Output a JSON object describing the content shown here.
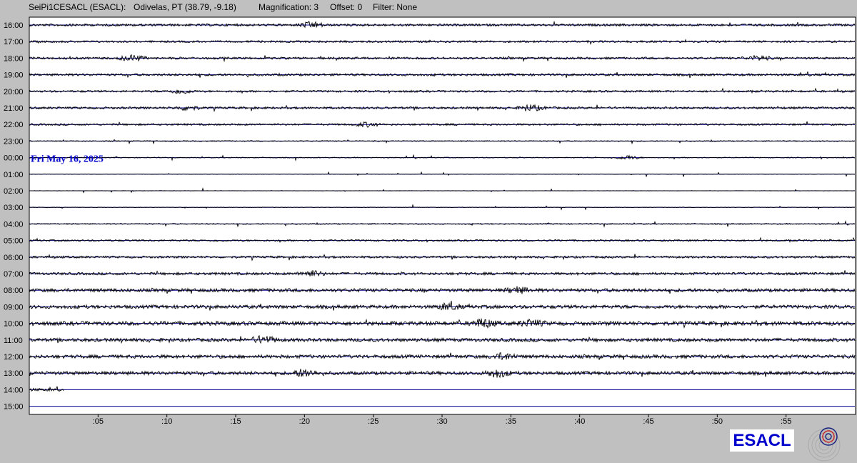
{
  "header": {
    "station": "SeiPi1CESACL (ESACL):",
    "location": "Odivelas, PT (38.79, -9.18)",
    "magnification": "Magnification: 3",
    "offset": "Offset: 0",
    "filter": "Filter: None"
  },
  "logo_text": "ESACL",
  "colors": {
    "trace": "#000000",
    "baseline": "#00008b",
    "date_label": "#0000cc",
    "background": "#c0c0c0",
    "plot": "#ffffff"
  },
  "chart_data": {
    "type": "line",
    "title": "",
    "date_annotation": {
      "text": "Fri May 16, 2025",
      "row": "00:00"
    },
    "rows": [
      "16:00",
      "17:00",
      "18:00",
      "19:00",
      "20:00",
      "21:00",
      "22:00",
      "23:00",
      "00:00",
      "01:00",
      "02:00",
      "03:00",
      "04:00",
      "05:00",
      "06:00",
      "07:00",
      "08:00",
      "09:00",
      "10:00",
      "11:00",
      "12:00",
      "13:00",
      "14:00",
      "15:00"
    ],
    "x_ticks": [
      ":05",
      ":10",
      ":15",
      ":20",
      ":25",
      ":30",
      ":35",
      ":40",
      ":45",
      ":50",
      ":55"
    ],
    "x_tick_minutes": [
      5,
      10,
      15,
      20,
      25,
      30,
      35,
      40,
      45,
      50,
      55
    ],
    "xlim": [
      0,
      60
    ],
    "noise_amplitude": [
      1.6,
      1.4,
      1.5,
      1.6,
      1.4,
      1.5,
      1.3,
      0.7,
      0.6,
      0.3,
      0.3,
      0.4,
      0.8,
      1.2,
      1.5,
      1.8,
      2.4,
      2.4,
      2.8,
      2.4,
      2.4,
      2.4,
      2.0,
      0
    ],
    "trace_end_minute": [
      60,
      60,
      60,
      60,
      60,
      60,
      60,
      60,
      60,
      60,
      60,
      60,
      60,
      60,
      60,
      60,
      60,
      60,
      60,
      60,
      60,
      60,
      2.5,
      0
    ],
    "bursts": [
      {
        "row": "16:00",
        "minute": 20.5,
        "amp": 4
      },
      {
        "row": "18:00",
        "minute": 7.5,
        "amp": 4
      },
      {
        "row": "18:00",
        "minute": 53,
        "amp": 3
      },
      {
        "row": "20:00",
        "minute": 11,
        "amp": 3
      },
      {
        "row": "21:00",
        "minute": 11.5,
        "amp": 3
      },
      {
        "row": "21:00",
        "minute": 36.5,
        "amp": 4
      },
      {
        "row": "22:00",
        "minute": 24.5,
        "amp": 3
      },
      {
        "row": "00:00",
        "minute": 43.5,
        "amp": 3
      },
      {
        "row": "07:00",
        "minute": 20.5,
        "amp": 4
      },
      {
        "row": "08:00",
        "minute": 35.5,
        "amp": 4
      },
      {
        "row": "09:00",
        "minute": 30.5,
        "amp": 4
      },
      {
        "row": "10:00",
        "minute": 33,
        "amp": 5
      },
      {
        "row": "10:00",
        "minute": 36.5,
        "amp": 4
      },
      {
        "row": "11:00",
        "minute": 17,
        "amp": 5
      },
      {
        "row": "12:00",
        "minute": 34.5,
        "amp": 4
      },
      {
        "row": "13:00",
        "minute": 20,
        "amp": 5
      },
      {
        "row": "13:00",
        "minute": 34,
        "amp": 5
      }
    ]
  }
}
